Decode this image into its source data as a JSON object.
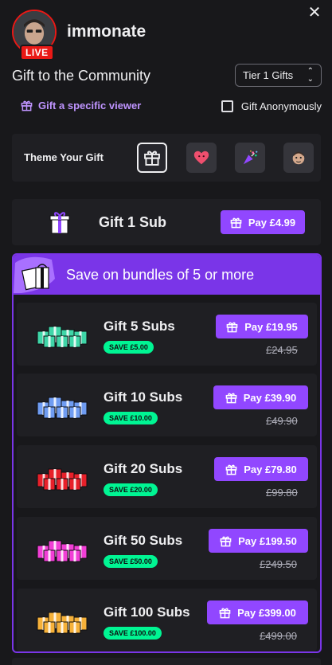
{
  "header": {
    "username": "immonate",
    "live_label": "LIVE"
  },
  "title": "Gift to the Community",
  "tier_select": {
    "value": "Tier 1 Gifts"
  },
  "gift_specific_label": "Gift a specific viewer",
  "gift_anonymously_label": "Gift Anonymously",
  "theme": {
    "label": "Theme Your Gift",
    "options": [
      {
        "icon": "gift-box-icon",
        "selected": true
      },
      {
        "icon": "heart-icon",
        "selected": false
      },
      {
        "icon": "confetti-icon",
        "selected": false
      },
      {
        "icon": "emote-icon",
        "selected": false
      }
    ]
  },
  "single": {
    "label": "Gift 1 Sub",
    "pay_label": "Pay £4.99"
  },
  "bundles": {
    "heading": "Save on bundles of 5 or more",
    "items": [
      {
        "label": "Gift 5 Subs",
        "save": "SAVE £5.00",
        "pay_label": "Pay £19.95",
        "original": "£24.95",
        "color": "#3fd6a8"
      },
      {
        "label": "Gift 10 Subs",
        "save": "SAVE £10.00",
        "pay_label": "Pay £39.90",
        "original": "£49.90",
        "color": "#6f9cf2"
      },
      {
        "label": "Gift 20 Subs",
        "save": "SAVE £20.00",
        "pay_label": "Pay £79.80",
        "original": "£99.80",
        "color": "#e8202a"
      },
      {
        "label": "Gift 50 Subs",
        "save": "SAVE £50.00",
        "pay_label": "Pay £199.50",
        "original": "£249.50",
        "color": "#f13fd6"
      },
      {
        "label": "Gift 100 Subs",
        "save": "SAVE £100.00",
        "pay_label": "Pay £399.00",
        "original": "£499.00",
        "color": "#f6b13a"
      }
    ]
  },
  "colors": {
    "accent": "#9147ff",
    "live": "#e91916",
    "save_badge": "#00f593",
    "bundle_header": "#7a35e8"
  }
}
